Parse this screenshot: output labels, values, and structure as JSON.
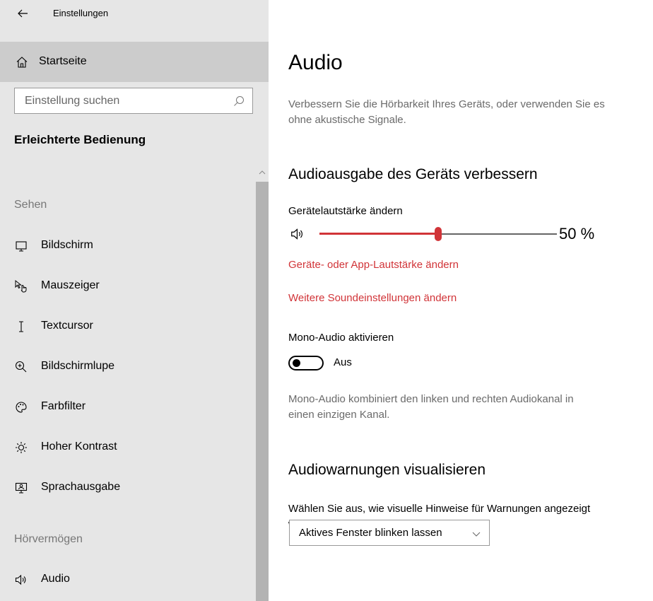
{
  "app": {
    "title": "Einstellungen"
  },
  "sidebar": {
    "home_label": "Startseite",
    "search_placeholder": "Einstellung suchen",
    "section_title": "Erleichterte Bedienung",
    "groups": [
      {
        "label": "Sehen",
        "items": [
          {
            "label": "Bildschirm",
            "icon": "monitor-icon"
          },
          {
            "label": "Mauszeiger",
            "icon": "mouse-pointer-icon"
          },
          {
            "label": "Textcursor",
            "icon": "text-cursor-icon"
          },
          {
            "label": "Bildschirmlupe",
            "icon": "magnifier-icon"
          },
          {
            "label": "Farbfilter",
            "icon": "palette-icon"
          },
          {
            "label": "Hoher Kontrast",
            "icon": "brightness-icon"
          },
          {
            "label": "Sprachausgabe",
            "icon": "narrator-icon"
          }
        ]
      },
      {
        "label": "Hörvermögen",
        "items": [
          {
            "label": "Audio",
            "icon": "speaker-icon"
          }
        ]
      }
    ]
  },
  "main": {
    "title": "Audio",
    "description_line1": "Verbessern Sie die Hörbarkeit Ihres Geräts, oder verwenden Sie es",
    "description_line2": "ohne akustische Signale.",
    "section1": {
      "heading": "Audioausgabe des Geräts verbessern",
      "volume_label": "Gerätelautstärke ändern",
      "volume_value": "50 %",
      "volume_level_percent": 50,
      "link_app_volume": "Geräte- oder App-Lautstärke ändern",
      "link_sound_settings": "Weitere Soundeinstellungen ändern",
      "mono_label": "Mono-Audio aktivieren",
      "mono_state": "Aus",
      "mono_on": false,
      "mono_note_line1": "Mono-Audio kombiniert den linken und rechten Audiokanal in",
      "mono_note_line2": "einen einzigen Kanal."
    },
    "section2": {
      "heading": "Audiowarnungen visualisieren",
      "hint_line1": "Wählen Sie aus, wie visuelle Hinweise für Warnungen angezeigt",
      "hint_line2": "werden.",
      "selected_option": "Aktives Fenster blinken lassen"
    }
  },
  "colors": {
    "accent": "#d13438",
    "sidebar_bg": "#e6e6e6",
    "home_selected_bg": "#cccccc",
    "secondary_text": "#6a6a6a"
  }
}
